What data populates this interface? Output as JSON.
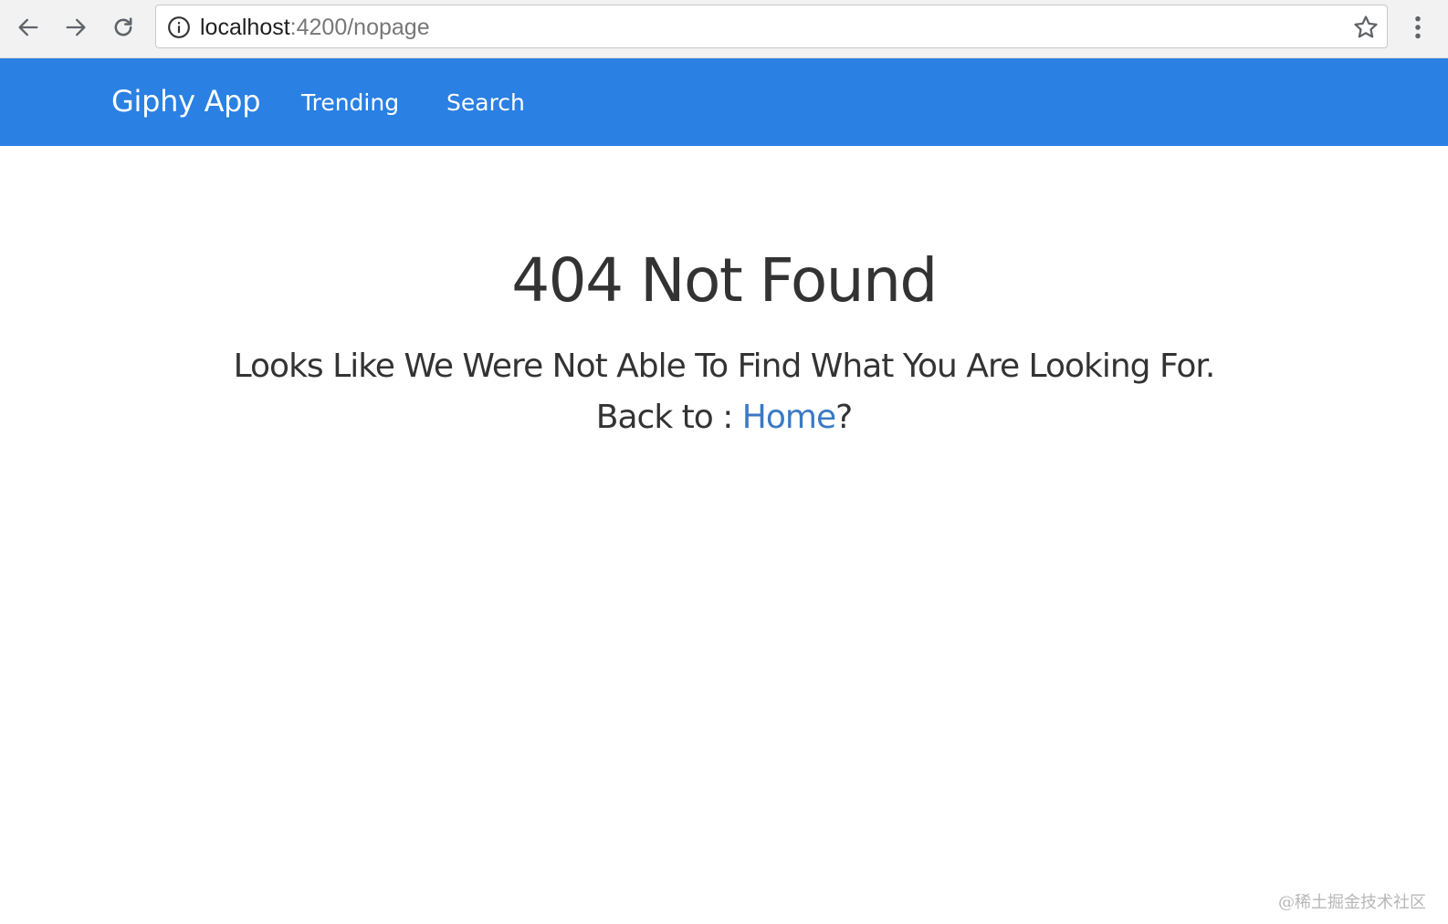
{
  "browser": {
    "url_host": "localhost",
    "url_rest": ":4200/nopage"
  },
  "navbar": {
    "brand": "Giphy App",
    "links": [
      {
        "label": "Trending"
      },
      {
        "label": "Search"
      }
    ],
    "color": "#2a80e3"
  },
  "content": {
    "title": "404 Not Found",
    "message": "Looks Like We Were Not Able To Find What You Are Looking For.",
    "back_prefix": "Back to : ",
    "home_link": "Home",
    "back_suffix": "?",
    "link_color": "#3b79c4"
  },
  "watermark": "@稀土掘金技术社区"
}
